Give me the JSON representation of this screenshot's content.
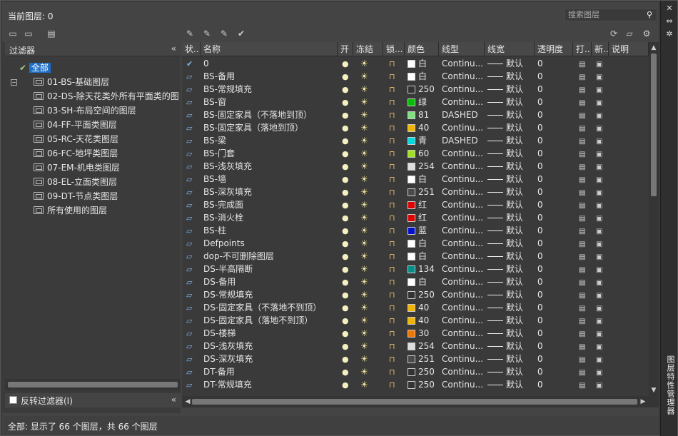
{
  "current_layer": "当前图层: 0",
  "search_placeholder": "搜索图层",
  "strip_title": "图层特性管理器",
  "filter_header": "过滤器",
  "tree": {
    "root": "全部",
    "items": [
      "01-BS-基础图层",
      "02-DS-除天花类外所有平面类的图",
      "03-SH-布局空间的图层",
      "04-FF-平面类图层",
      "05-RC-天花类图层",
      "06-FC-地坪类图层",
      "07-EM-机电类图层",
      "08-EL-立面类图层",
      "09-DT-节点类图层",
      "所有使用的图层"
    ]
  },
  "invert_filter": "反转过滤器(I)",
  "columns": [
    "状..",
    "名称",
    "开",
    "冻结",
    "锁...",
    "颜色",
    "线型",
    "线宽",
    "透明度",
    "打...",
    "新...",
    "说明"
  ],
  "rows": [
    {
      "name": "0",
      "color": "白",
      "hex": "#ffffff",
      "linetype": "Continu...",
      "lw": "默认",
      "tr": "0",
      "cur": true
    },
    {
      "name": "BS-备用",
      "color": "白",
      "hex": "#ffffff",
      "linetype": "Continu...",
      "lw": "默认",
      "tr": "0"
    },
    {
      "name": "BS-常规填充",
      "color": "250",
      "hex": "#333333",
      "linetype": "Continu...",
      "lw": "默认",
      "tr": "0"
    },
    {
      "name": "BS-窗",
      "color": "绿",
      "hex": "#00c000",
      "linetype": "Continu...",
      "lw": "默认",
      "tr": "0"
    },
    {
      "name": "BS-固定家具（不落地到顶）",
      "color": "81",
      "hex": "#7fe07f",
      "linetype": "DASHED",
      "lw": "默认",
      "tr": "0"
    },
    {
      "name": "BS-固定家具（落地到顶）",
      "color": "40",
      "hex": "#f2b400",
      "linetype": "Continu...",
      "lw": "默认",
      "tr": "0"
    },
    {
      "name": "BS-梁",
      "color": "青",
      "hex": "#00d8e0",
      "linetype": "DASHED",
      "lw": "默认",
      "tr": "0"
    },
    {
      "name": "BS-门套",
      "color": "60",
      "hex": "#a0e020",
      "linetype": "Continu...",
      "lw": "默认",
      "tr": "0"
    },
    {
      "name": "BS-浅灰填充",
      "color": "254",
      "hex": "#dddddd",
      "linetype": "Continu...",
      "lw": "默认",
      "tr": "0"
    },
    {
      "name": "BS-墙",
      "color": "白",
      "hex": "#ffffff",
      "linetype": "Continu...",
      "lw": "默认",
      "tr": "0"
    },
    {
      "name": "BS-深灰填充",
      "color": "251",
      "hex": "#4a4a4a",
      "linetype": "Continu...",
      "lw": "默认",
      "tr": "0"
    },
    {
      "name": "BS-完成面",
      "color": "红",
      "hex": "#e00000",
      "linetype": "Continu...",
      "lw": "默认",
      "tr": "0"
    },
    {
      "name": "BS-消火栓",
      "color": "红",
      "hex": "#e00000",
      "linetype": "Continu...",
      "lw": "默认",
      "tr": "0"
    },
    {
      "name": "BS-柱",
      "color": "蓝",
      "hex": "#0010d0",
      "linetype": "Continu...",
      "lw": "默认",
      "tr": "0"
    },
    {
      "name": "Defpoints",
      "color": "白",
      "hex": "#ffffff",
      "linetype": "Continu...",
      "lw": "默认",
      "tr": "0"
    },
    {
      "name": "dop-不可删除图层",
      "color": "白",
      "hex": "#ffffff",
      "linetype": "Continu...",
      "lw": "默认",
      "tr": "0"
    },
    {
      "name": "DS-半高隔断",
      "color": "134",
      "hex": "#00908a",
      "linetype": "Continu...",
      "lw": "默认",
      "tr": "0"
    },
    {
      "name": "DS-备用",
      "color": "白",
      "hex": "#ffffff",
      "linetype": "Continu...",
      "lw": "默认",
      "tr": "0"
    },
    {
      "name": "DS-常规填充",
      "color": "250",
      "hex": "#333333",
      "linetype": "Continu...",
      "lw": "默认",
      "tr": "0"
    },
    {
      "name": "DS-固定家具（不落地不到顶）",
      "color": "40",
      "hex": "#f2b400",
      "linetype": "Continu...",
      "lw": "默认",
      "tr": "0"
    },
    {
      "name": "DS-固定家具（落地不到顶）",
      "color": "40",
      "hex": "#f2b400",
      "linetype": "Continu...",
      "lw": "默认",
      "tr": "0"
    },
    {
      "name": "DS-楼梯",
      "color": "30",
      "hex": "#f07800",
      "linetype": "Continu...",
      "lw": "默认",
      "tr": "0"
    },
    {
      "name": "DS-浅灰填充",
      "color": "254",
      "hex": "#dddddd",
      "linetype": "Continu...",
      "lw": "默认",
      "tr": "0"
    },
    {
      "name": "DS-深灰填充",
      "color": "251",
      "hex": "#4a4a4a",
      "linetype": "Continu...",
      "lw": "默认",
      "tr": "0"
    },
    {
      "name": "DT-备用",
      "color": "250",
      "hex": "#333333",
      "linetype": "Continu...",
      "lw": "默认",
      "tr": "0"
    },
    {
      "name": "DT-常规填充",
      "color": "250",
      "hex": "#333333",
      "linetype": "Continu...",
      "lw": "默认",
      "tr": "0"
    }
  ],
  "status": "全部: 显示了 66 个图层，共 66 个图层"
}
